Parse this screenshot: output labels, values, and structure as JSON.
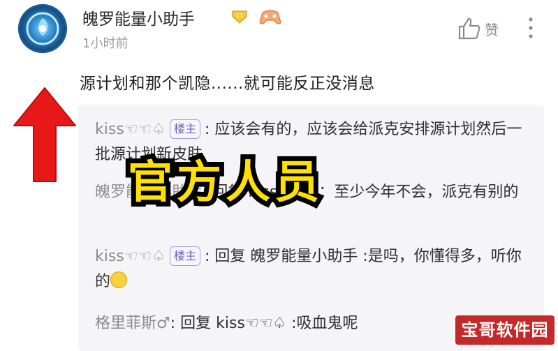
{
  "post": {
    "username": "魄罗能量小助手",
    "level_badge": "11",
    "time": "1小时前",
    "like_label": "赞",
    "content": "源计划和那个凯隐......就可能反正没消息"
  },
  "replies": [
    {
      "name": "kiss☜☜♤",
      "tag": "楼主",
      "text": "应该会有的，应该会给派克安排源计划然后一批源计划新皮肤"
    },
    {
      "name": "魄罗能量小助手",
      "text": "回复 kiss☜☜♤：至少今年不会，派克有别的"
    },
    {
      "name": "kiss☜☜♤",
      "tag": "楼主",
      "text": "回复 魄罗能量小助手 :是吗，你懂得多，听你的"
    },
    {
      "name": "格里菲斯♂",
      "text": "回复 kiss☜☜♤ :吸血鬼呢"
    }
  ],
  "overlay_text": "官方人员",
  "watermark": "宝哥软件园",
  "colors": {
    "overlay": "#ffe100",
    "arrow": "#e81818",
    "tag": "#6b5fb8",
    "watermark_bg": "#c21f1f"
  }
}
